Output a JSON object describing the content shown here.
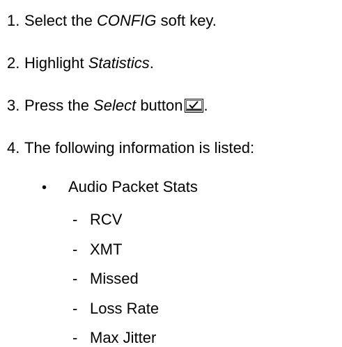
{
  "steps": [
    {
      "num": "1.",
      "pre": "Select the ",
      "em": "CONFIG",
      "post": " soft key."
    },
    {
      "num": "2.",
      "pre": "Highlight ",
      "em": "Statistics",
      "post": "."
    },
    {
      "num": "3.",
      "pre": "Press the ",
      "em": "Select",
      "post": " button",
      "tail": ".",
      "icon": "select-button-icon"
    },
    {
      "num": "4.",
      "text": "The following information is listed:"
    }
  ],
  "bullet": {
    "marker": "•",
    "text": "Audio Packet Stats"
  },
  "sub_items": [
    {
      "dash": "-",
      "text": "RCV"
    },
    {
      "dash": "-",
      "text": "XMT"
    },
    {
      "dash": "-",
      "text": "Missed"
    },
    {
      "dash": "-",
      "text": "Loss Rate"
    },
    {
      "dash": "-",
      "text": "Max Jitter"
    }
  ]
}
